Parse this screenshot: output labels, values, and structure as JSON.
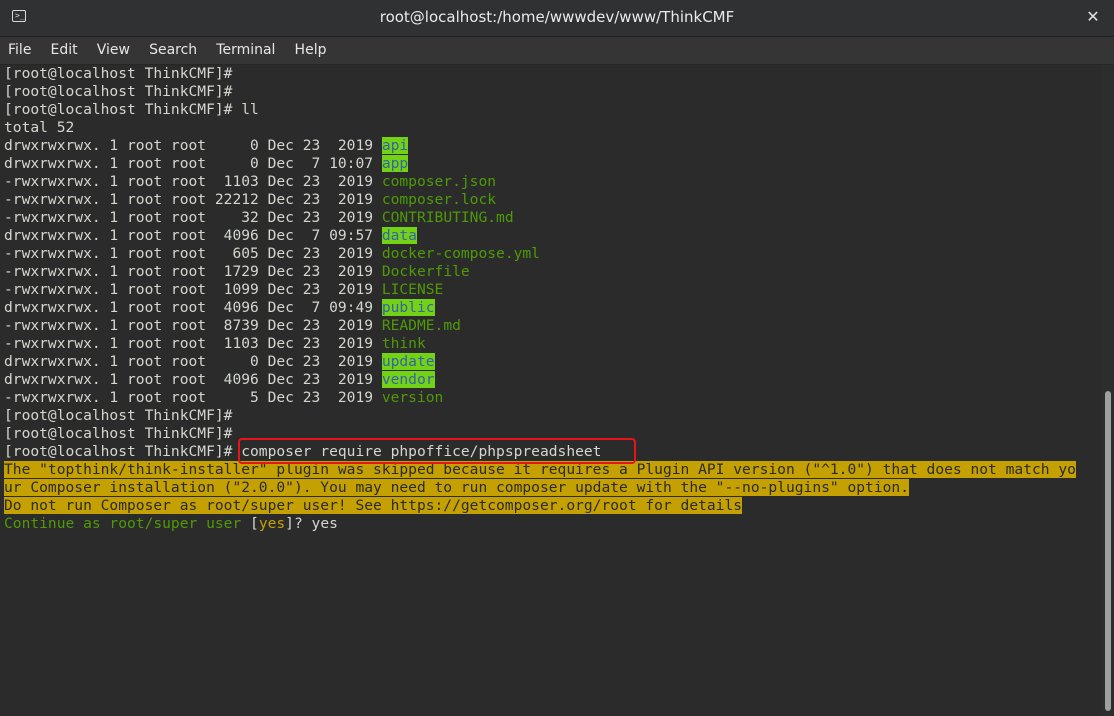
{
  "window": {
    "title": "root@localhost:/home/wwwdev/www/ThinkCMF",
    "icon": "terminal-icon",
    "close_glyph": "✕"
  },
  "menu": [
    "File",
    "Edit",
    "View",
    "Search",
    "Terminal",
    "Help"
  ],
  "terminal": {
    "prompt": "[root@localhost ThinkCMF]# ",
    "pre_lines": [
      "[root@localhost ThinkCMF]#",
      "[root@localhost ThinkCMF]#",
      "[root@localhost ThinkCMF]# ll",
      "total 52"
    ],
    "listing": [
      {
        "meta": "drwxrwxrwx. 1 root root     0 Dec 23  2019 ",
        "name": "api",
        "type": "dir"
      },
      {
        "meta": "drwxrwxrwx. 1 root root     0 Dec  7 10:07 ",
        "name": "app",
        "type": "dir"
      },
      {
        "meta": "-rwxrwxrwx. 1 root root  1103 Dec 23  2019 ",
        "name": "composer.json",
        "type": "file"
      },
      {
        "meta": "-rwxrwxrwx. 1 root root 22212 Dec 23  2019 ",
        "name": "composer.lock",
        "type": "file"
      },
      {
        "meta": "-rwxrwxrwx. 1 root root    32 Dec 23  2019 ",
        "name": "CONTRIBUTING.md",
        "type": "file"
      },
      {
        "meta": "drwxrwxrwx. 1 root root  4096 Dec  7 09:57 ",
        "name": "data",
        "type": "dir"
      },
      {
        "meta": "-rwxrwxrwx. 1 root root   605 Dec 23  2019 ",
        "name": "docker-compose.yml",
        "type": "file"
      },
      {
        "meta": "-rwxrwxrwx. 1 root root  1729 Dec 23  2019 ",
        "name": "Dockerfile",
        "type": "file"
      },
      {
        "meta": "-rwxrwxrwx. 1 root root  1099 Dec 23  2019 ",
        "name": "LICENSE",
        "type": "file"
      },
      {
        "meta": "drwxrwxrwx. 1 root root  4096 Dec  7 09:49 ",
        "name": "public",
        "type": "dir"
      },
      {
        "meta": "-rwxrwxrwx. 1 root root  8739 Dec 23  2019 ",
        "name": "README.md",
        "type": "file"
      },
      {
        "meta": "-rwxrwxrwx. 1 root root  1103 Dec 23  2019 ",
        "name": "think",
        "type": "file"
      },
      {
        "meta": "drwxrwxrwx. 1 root root     0 Dec 23  2019 ",
        "name": "update",
        "type": "dir"
      },
      {
        "meta": "drwxrwxrwx. 1 root root  4096 Dec 23  2019 ",
        "name": "vendor",
        "type": "dir"
      },
      {
        "meta": "-rwxrwxrwx. 1 root root     5 Dec 23  2019 ",
        "name": "version",
        "type": "file"
      }
    ],
    "post_lines": [
      "[root@localhost ThinkCMF]#",
      "[root@localhost ThinkCMF]#"
    ],
    "command_prompt": "[root@localhost ThinkCMF]#",
    "command": " composer require phpoffice/phpspreadsheet ",
    "warnings": [
      "The \"topthink/think-installer\" plugin was skipped because it requires a Plugin API version (\"^1.0\") that does not match yo",
      "ur Composer installation (\"2.0.0\"). You may need to run composer update with the \"--no-plugins\" option.",
      "Do not run Composer as root/super user! See https://getcomposer.org/root for details"
    ],
    "question_text": "Continue as root/super user ",
    "question_open": "[",
    "question_default": "yes",
    "question_close": "]? ",
    "answer": "yes"
  },
  "colors": {
    "background": "#2b2b2b",
    "text": "#d3d7cf",
    "dir_fg": "#3465a4",
    "dir_bg": "#73d216",
    "file_fg": "#4e9a06",
    "warning_bg": "#c4a000",
    "highlight_border": "#e8141c"
  }
}
